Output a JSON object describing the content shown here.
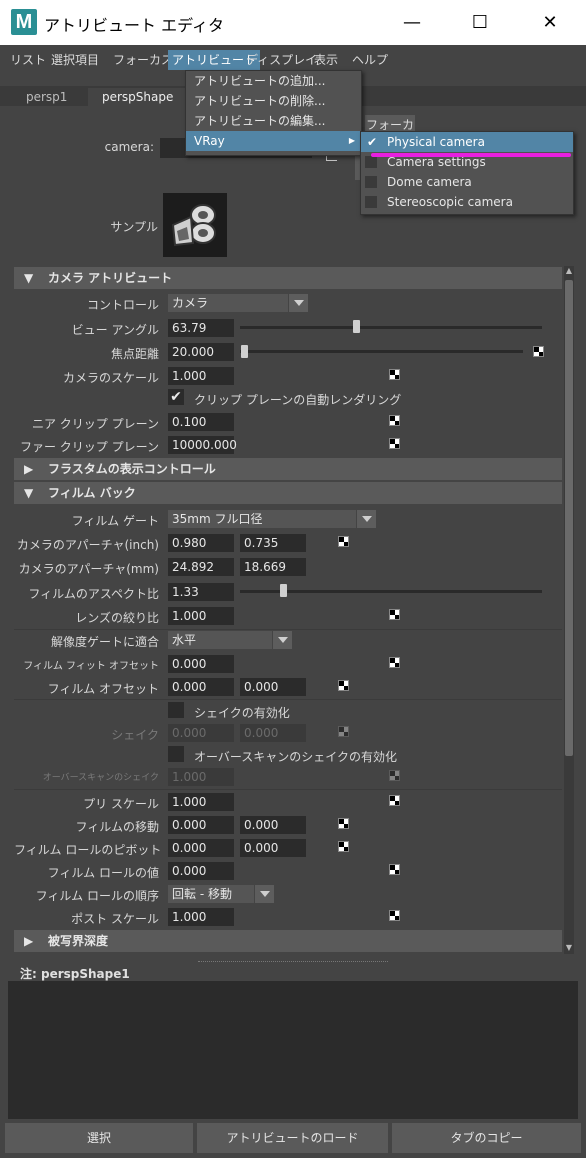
{
  "window": {
    "title": "アトリビュート エディタ",
    "app_icon_letter": "M"
  },
  "window_controls": {
    "minimize": "—",
    "maximize": "☐",
    "close": "✕"
  },
  "menubar": [
    {
      "label": "リスト"
    },
    {
      "label": "選択項目"
    },
    {
      "label": "フォーカス"
    },
    {
      "label": "アトリビュート",
      "active": true
    },
    {
      "label": "ディスプレイ"
    },
    {
      "label": "表示"
    },
    {
      "label": "ヘルプ"
    }
  ],
  "tabs": [
    {
      "label": "persp1"
    },
    {
      "label": "perspShape"
    }
  ],
  "focus_button": "フォーカス",
  "camera_row": {
    "label": "camera:"
  },
  "sample": {
    "label": "サンプル"
  },
  "attribute_menu": {
    "items": [
      "アトリビュートの追加...",
      "アトリビュートの削除...",
      "アトリビュートの編集...",
      "VRay"
    ],
    "submenu_arrow": "▶"
  },
  "vray_submenu": {
    "items": [
      {
        "label": "Physical camera",
        "checked": true,
        "highlighted": true
      },
      {
        "label": "Camera settings",
        "checked": false
      },
      {
        "label": "Dome camera",
        "checked": false
      },
      {
        "label": "Stereoscopic camera",
        "checked": false
      }
    ],
    "checkmark": "✔",
    "annotation_color": "#e81fe0"
  },
  "camera_attributes": {
    "header": "カメラ アトリビュート",
    "control": {
      "label": "コントロール",
      "value": "カメラ"
    },
    "angle_of_view": {
      "label": "ビュー アングル",
      "value": "63.79"
    },
    "focal_length": {
      "label": "焦点距離",
      "value": "20.000"
    },
    "camera_scale": {
      "label": "カメラのスケール",
      "value": "1.000"
    },
    "auto_render_clip": {
      "label": "クリップ プレーンの自動レンダリング",
      "checked": true
    },
    "near_clip": {
      "label": "ニア クリップ プレーン",
      "value": "0.100"
    },
    "far_clip": {
      "label": "ファー クリップ プレーン",
      "value": "10000.000"
    }
  },
  "frustum_section": {
    "header": "フラスタムの表示コントロール"
  },
  "film_back": {
    "header": "フィルム バック",
    "film_gate": {
      "label": "フィルム ゲート",
      "value": "35mm フル口径"
    },
    "aperture_inch": {
      "label": "カメラのアパーチャ(inch)",
      "value1": "0.980",
      "value2": "0.735"
    },
    "aperture_mm": {
      "label": "カメラのアパーチャ(mm)",
      "value1": "24.892",
      "value2": "18.669"
    },
    "aspect_ratio": {
      "label": "フィルムのアスペクト比",
      "value": "1.33"
    },
    "lens_squeeze": {
      "label": "レンズの絞り比",
      "value": "1.000"
    },
    "fit_resolution_gate": {
      "label": "解像度ゲートに適合",
      "value": "水平"
    },
    "film_fit_offset": {
      "label": "フィルム フィット オフセット",
      "value": "0.000"
    },
    "film_offset": {
      "label": "フィルム オフセット",
      "value1": "0.000",
      "value2": "0.000"
    },
    "shake_enabled": {
      "label": "シェイクの有効化",
      "checked": false
    },
    "shake": {
      "label": "シェイク",
      "value1": "0.000",
      "value2": "0.000"
    },
    "shake_overscan_enabled": {
      "label": "オーバースキャンのシェイクの有効化",
      "checked": false
    },
    "shake_overscan": {
      "label": "オーバースキャンのシェイク",
      "value": "1.000"
    },
    "pre_scale": {
      "label": "プリ スケール",
      "value": "1.000"
    },
    "film_translate": {
      "label": "フィルムの移動",
      "value1": "0.000",
      "value2": "0.000"
    },
    "film_roll_pivot": {
      "label": "フィルム ロールのピボット",
      "value1": "0.000",
      "value2": "0.000"
    },
    "film_roll_value": {
      "label": "フィルム ロールの値",
      "value": "0.000"
    },
    "film_roll_order": {
      "label": "フィルム ロールの順序",
      "value": "回転 - 移動"
    },
    "post_scale": {
      "label": "ポスト スケール",
      "value": "1.000"
    }
  },
  "dof_section": {
    "header": "被写界深度"
  },
  "notes": {
    "label": "注:  perspShape1"
  },
  "bottom_buttons": {
    "select": "選択",
    "load_attributes": "アトリビュートのロード",
    "copy_tab": "タブのコピー"
  }
}
